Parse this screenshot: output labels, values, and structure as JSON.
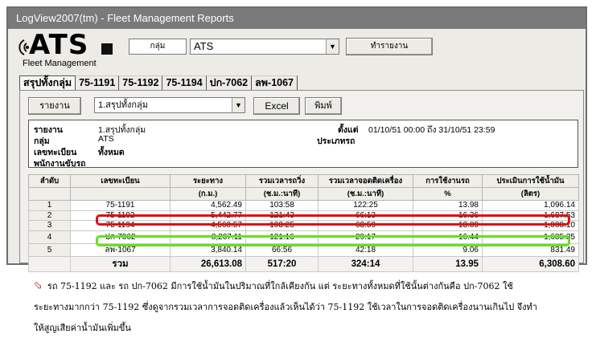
{
  "window": {
    "title": "LogView2007(tm) - Fleet Management Reports"
  },
  "logo": {
    "text": "ATS",
    "subtext": "Fleet Management"
  },
  "toolbar": {
    "group_label": "กลุ่ม",
    "group_value": "ATS",
    "run_button": "ทำรายงาน"
  },
  "tabs": [
    "สรุปทั้งกลุ่ม",
    "75-1191",
    "75-1192",
    "75-1194",
    "ปก-7062",
    "ลพ-1067"
  ],
  "report_bar": {
    "report_label": "รายงาน",
    "report_value": "1.สรุปทั้งกลุ่ม",
    "excel_button": "Excel",
    "print_button": "พิมพ์"
  },
  "info": {
    "report_label": "รายงาน",
    "report_value": "1.สรุปทั้งกลุ่ม",
    "group_label": "กลุ่ม",
    "group_value": "ATS",
    "plate_label": "เลขทะเบียน",
    "plate_value": "ทั้งหมด",
    "driver_label": "พนักงานขับรถ",
    "since_label": "ตั้งแต่",
    "since_value": "01/10/51  00:00 ถึง 31/10/51  23:59",
    "type_label": "ประเภทรถ"
  },
  "table": {
    "headers": [
      "ลำดับ",
      "เลขทะเบียน",
      "ระยะทาง",
      "รวมเวลารถวิ่ง",
      "รวมเวลาจอดติดเครื่อง",
      "การใช้งานรถ",
      "ประเมินการใช้น้ำมัน"
    ],
    "units": [
      "",
      "",
      "(ก.ม.)",
      "(ช.ม.:นาที)",
      "(ช.ม.:นาที)",
      "%",
      "(ลิตร)"
    ],
    "rows": [
      [
        "1",
        "75-1191",
        "4,562.49",
        "103:58",
        "122:25",
        "13.98",
        "1,096.14"
      ],
      [
        "2",
        "75-1192",
        "5,442.77",
        "121:43",
        "66:13",
        "16.36",
        "1,687.53"
      ],
      [
        "3",
        "75-1194",
        "4,560.57",
        "103:25",
        "63:59",
        "13.89",
        "1,008.10"
      ],
      [
        "4",
        "ปก-7062",
        "8,207.11",
        "121:16",
        "29:17",
        "16.44",
        "1,685.35"
      ],
      [
        "5",
        "ลพ-1067",
        "3,840.14",
        "66:56",
        "42:18",
        "9.06",
        "831.49"
      ]
    ],
    "total": [
      "",
      "รวม",
      "26,613.08",
      "517:20",
      "324:14",
      "13.95",
      "6,308.60"
    ]
  },
  "highlight": {
    "red": "#e01010",
    "green": "#66e020"
  },
  "note": {
    "line1": "รถ 75-1192 และ รถ ปก-7062 มีการใช้น้ำมันในปริมาณที่ใกล้เคียงกัน แต่ ระยะทางทั้งหมดที่ใช้นั้นต่างกันคือ ปก-7062 ใช้",
    "line2": "ระยะทางมากกว่า 75-1192 ซึ่งดูจากรวมเวลาการจอดติดเครื่องแล้วเห็นได้ว่า 75-1192 ใช้เวลาในการจอดติดเครื่องนานเกินไป จึงทำ",
    "line3": "ให้สูญเสียค่าน้ำมันเพิ่มขึ้น"
  }
}
